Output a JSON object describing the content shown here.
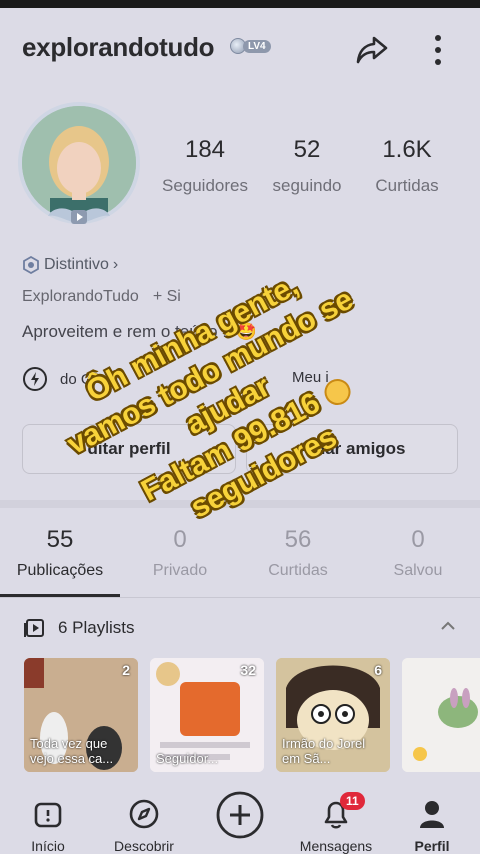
{
  "header": {
    "username": "explorandotudo",
    "level_badge": "LV4",
    "share_icon": "share-arrow-icon",
    "more_icon": "more-vertical-icon"
  },
  "profile": {
    "stats": [
      {
        "value": "184",
        "label": "Seguidores"
      },
      {
        "value": "52",
        "label": "seguindo"
      },
      {
        "value": "1.6K",
        "label": "Curtidas"
      }
    ],
    "distintivo": "Distintivo",
    "display_name": "ExplorandoTudo",
    "add_label": "+ Si",
    "bio": "Aproveitem e    rem o   teúdo !i 🤩",
    "link_text": "do G",
    "link_extra": "Meu i     ",
    "edit_button": "ditar perfil",
    "add_friends_button": "A     nar amigos"
  },
  "tabs": [
    {
      "count": "55",
      "label": "Publicações",
      "active": true
    },
    {
      "count": "0",
      "label": "Privado",
      "active": false
    },
    {
      "count": "56",
      "label": "Curtidas",
      "active": false
    },
    {
      "count": "0",
      "label": "Salvou",
      "active": false
    }
  ],
  "playlists": {
    "label": "6 Playlists",
    "items": [
      {
        "count": "2",
        "caption": "Toda vez que vejo essa ca..."
      },
      {
        "count": "32",
        "caption": "Seguidor..."
      },
      {
        "count": "6",
        "caption": "Irmão do Jorel em Sã..."
      },
      {
        "count": "",
        "caption": ""
      }
    ]
  },
  "overlay": {
    "lines": [
      "Ôh minha gente,",
      "vamos todo mundo se",
      "ajudar",
      "Faltam 99.816",
      "seguidores"
    ]
  },
  "nav": {
    "items": [
      {
        "label": "Início",
        "icon": "home-icon"
      },
      {
        "label": "Descobrir",
        "icon": "compass-icon"
      },
      {
        "label": "",
        "icon": "plus-icon"
      },
      {
        "label": "Mensagens",
        "icon": "bell-icon",
        "badge": "11"
      },
      {
        "label": "Perfil",
        "icon": "person-icon"
      }
    ]
  }
}
